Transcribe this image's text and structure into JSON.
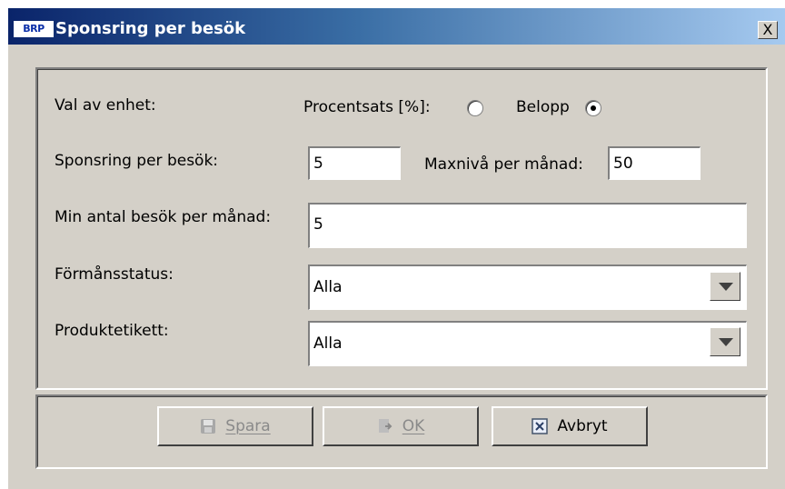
{
  "window": {
    "title": "Sponsring per besök",
    "logo_text": "BRP",
    "close_label": "X"
  },
  "form": {
    "unit_label": "Val av enhet:",
    "percent_label": "Procentsats [%]:",
    "amount_label": "Belopp",
    "selected_unit": "Belopp",
    "sponsor_label": "Sponsring per besök:",
    "sponsor_value": "5",
    "max_label": "Maxnivå per månad:",
    "max_value": "50",
    "min_visits_label": "Min antal besök per månad:",
    "min_visits_value": "5",
    "benefit_status_label": "Förmånsstatus:",
    "benefit_status_value": "Alla",
    "product_label_label": "Produktetikett:",
    "product_label_value": "Alla"
  },
  "buttons": {
    "save_label": "Spara",
    "ok_label": "OK",
    "cancel_label": "Avbryt"
  },
  "icons": {
    "save": "floppy-disk-icon",
    "ok": "document-arrow-icon",
    "cancel": "cross-box-icon"
  }
}
